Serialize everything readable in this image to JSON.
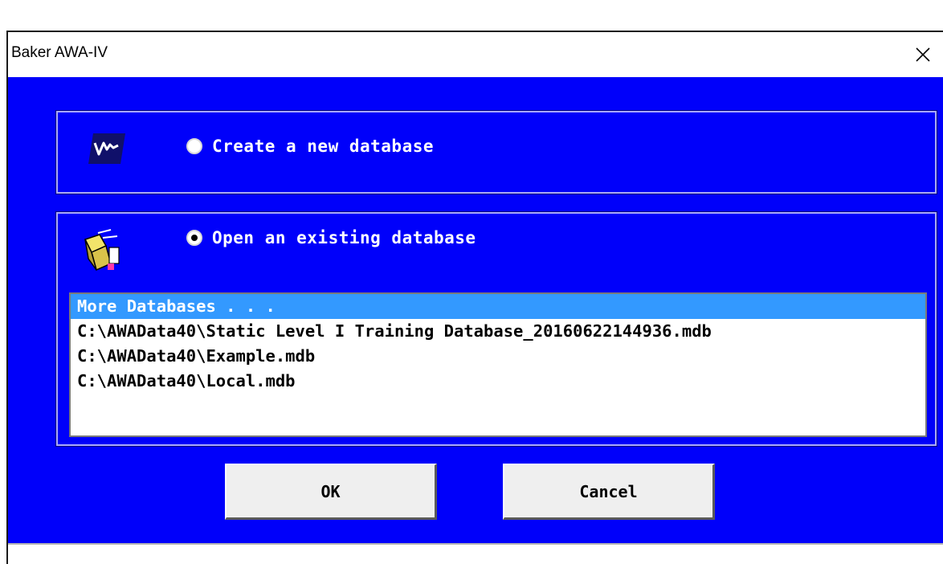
{
  "window": {
    "title": "Baker AWA-IV",
    "close_icon": "close-icon"
  },
  "colors": {
    "client_background": "#0000fa",
    "selection": "#3399ff"
  },
  "create_section": {
    "icon": "waveform-app-icon",
    "radio_label": "Create a new database",
    "selected": false
  },
  "open_section": {
    "icon": "open-folder-icon",
    "radio_label": "Open an existing database",
    "selected": true
  },
  "database_list": {
    "selected_index": 0,
    "items": [
      {
        "label": "More Databases . . ."
      },
      {
        "label": "C:\\AWAData40\\Static Level I Training Database_20160622144936.mdb"
      },
      {
        "label": "C:\\AWAData40\\Example.mdb"
      },
      {
        "label": "C:\\AWAData40\\Local.mdb"
      }
    ]
  },
  "buttons": {
    "ok_label": "OK",
    "cancel_label": "Cancel"
  }
}
